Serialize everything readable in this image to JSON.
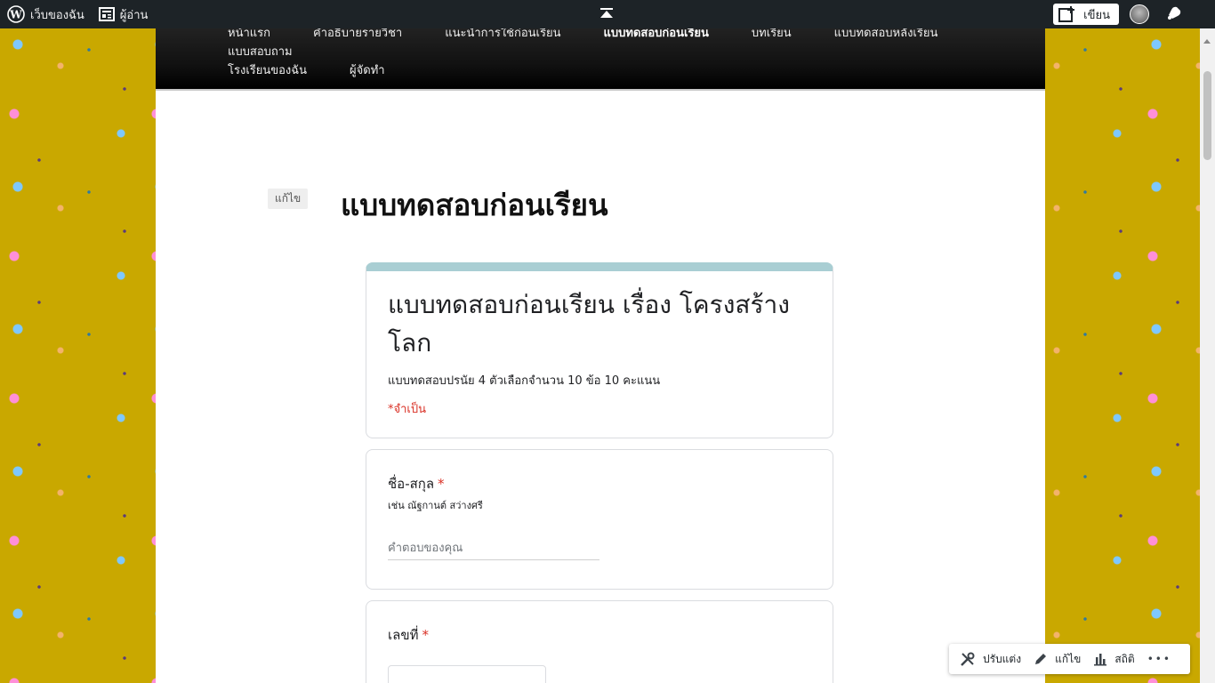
{
  "adminbar": {
    "my_sites": "เว็บของฉัน",
    "reader": "ผู้อ่าน",
    "write": "เขียน"
  },
  "nav": {
    "row1": [
      "หน้าแรก",
      "คำอธิบายรายวิชา",
      "แนะนำการใช้ก่อนเรียน",
      "แบบทดสอบก่อนเรียน",
      "บทเรียน",
      "แบบทดสอบหลังเรียน",
      "แบบสอบถาม"
    ],
    "row2": [
      "โรงเรียนของฉัน",
      "ผู้จัดทำ"
    ],
    "active": "แบบทดสอบก่อนเรียน"
  },
  "page": {
    "edit_label": "แก้ไข",
    "title": "แบบทดสอบก่อนเรียน"
  },
  "form": {
    "title": "แบบทดสอบก่อนเรียน เรื่อง โครงสร้างโลก",
    "description": "แบบทดสอบปรนัย 4 ตัวเลือกจำนวน 10 ข้อ 10 คะแนน",
    "required_note": "*จำเป็น",
    "q1": {
      "title": "ชื่อ-สกุล",
      "star": "*",
      "help": "เช่น ณัฐกานต์ สว่างศรี",
      "placeholder": "คำตอบของคุณ"
    },
    "q2": {
      "title": "เลขที่",
      "star": "*"
    }
  },
  "actions": {
    "customize": "ปรับแต่ง",
    "edit": "แก้ไข",
    "stats": "สถิติ",
    "more": "•••"
  },
  "colors": {
    "admin_bar": "#1d2327",
    "background": "#c9a800",
    "form_accent": "#a9ced3",
    "required": "#d93025"
  }
}
